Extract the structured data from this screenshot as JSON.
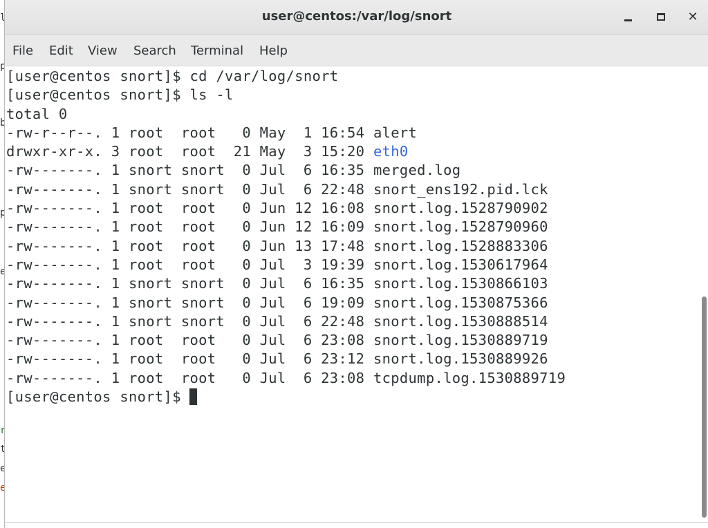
{
  "background_fragments": [
    "l",
    "p",
    "b",
    "p",
    "e",
    "r",
    "t",
    "e",
    "e"
  ],
  "window": {
    "title": "user@centos:/var/log/snort",
    "controls": {
      "minimize": "minimize",
      "maximize": "maximize",
      "close": "✕"
    }
  },
  "menu": {
    "items": [
      "File",
      "Edit",
      "View",
      "Search",
      "Terminal",
      "Help"
    ]
  },
  "terminal": {
    "lines": [
      {
        "text": "[user@centos snort]$ cd /var/log/snort"
      },
      {
        "text": "[user@centos snort]$ ls -l"
      },
      {
        "text": "total 0"
      },
      {
        "prefix": "-rw-r--r--. 1 root  root   0 May  1 16:54 ",
        "name": "alert",
        "type": "file"
      },
      {
        "prefix": "drwxr-xr-x. 3 root  root  21 May  3 15:20 ",
        "name": "eth0",
        "type": "directory"
      },
      {
        "prefix": "-rw-------. 1 snort snort  0 Jul  6 16:35 ",
        "name": "merged.log",
        "type": "file"
      },
      {
        "prefix": "-rw-------. 1 snort snort  0 Jul  6 22:48 ",
        "name": "snort_ens192.pid.lck",
        "type": "file"
      },
      {
        "prefix": "-rw-------. 1 root  root   0 Jun 12 16:08 ",
        "name": "snort.log.1528790902",
        "type": "file"
      },
      {
        "prefix": "-rw-------. 1 root  root   0 Jun 12 16:09 ",
        "name": "snort.log.1528790960",
        "type": "file"
      },
      {
        "prefix": "-rw-------. 1 root  root   0 Jun 13 17:48 ",
        "name": "snort.log.1528883306",
        "type": "file"
      },
      {
        "prefix": "-rw-------. 1 root  root   0 Jul  3 19:39 ",
        "name": "snort.log.1530617964",
        "type": "file"
      },
      {
        "prefix": "-rw-------. 1 snort snort  0 Jul  6 16:35 ",
        "name": "snort.log.1530866103",
        "type": "file"
      },
      {
        "prefix": "-rw-------. 1 snort snort  0 Jul  6 19:09 ",
        "name": "snort.log.1530875366",
        "type": "file"
      },
      {
        "prefix": "-rw-------. 1 snort snort  0 Jul  6 22:48 ",
        "name": "snort.log.1530888514",
        "type": "file"
      },
      {
        "prefix": "-rw-------. 1 root  root   0 Jul  6 23:08 ",
        "name": "snort.log.1530889719",
        "type": "file"
      },
      {
        "prefix": "-rw-------. 1 root  root   0 Jul  6 23:12 ",
        "name": "snort.log.1530889926",
        "type": "file"
      },
      {
        "prefix": "-rw-------. 1 root  root   0 Jul  6 23:08 ",
        "name": "tcpdump.log.1530889719",
        "type": "file"
      }
    ],
    "prompt": "[user@centos snort]$ "
  },
  "colors": {
    "directory": "#3465e0",
    "text": "#2e3436",
    "background": "#ffffff"
  }
}
